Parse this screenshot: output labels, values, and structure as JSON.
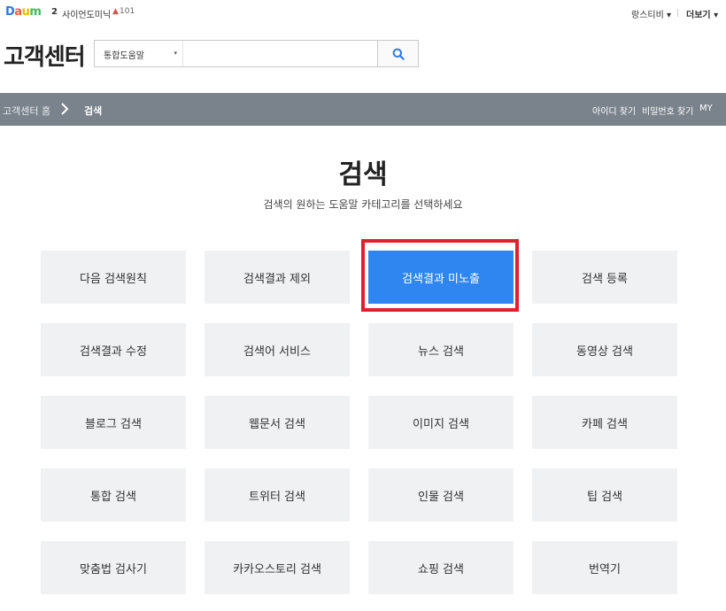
{
  "topbar": {
    "logo": [
      "D",
      "a",
      "u",
      "m",
      ""
    ],
    "rank_number": "2",
    "rank_term": "사이언도미닉",
    "rank_up_icon": "▲",
    "rank_count": "101",
    "user_label": "랑스티비 ▾",
    "more_label": "더보기 ▾"
  },
  "header": {
    "title": "고객센터",
    "search": {
      "select_value": "통합도움말",
      "select_caret": "▾",
      "input_value": "",
      "input_placeholder": "",
      "button_icon": "search-icon",
      "accent_color": "#2a7be4"
    }
  },
  "nav": {
    "breadcrumb_home": "고객센터 홈",
    "breadcrumb_current": "검색",
    "links": [
      "아이디 찾기",
      "비밀번호 찾기",
      "MY"
    ],
    "background_color": "#7a838b"
  },
  "main": {
    "title": "검색",
    "subtitle": "검색의 원하는 도움말 카테고리를 선택하세요",
    "tiles": [
      "다음 검색원칙",
      "검색결과 제외",
      "검색결과 미노출",
      "검색 등록",
      "검색결과 수정",
      "검색어 서비스",
      "뉴스 검색",
      "동영상 검색",
      "블로그 검색",
      "웹문서 검색",
      "이미지 검색",
      "카페 검색",
      "통합 검색",
      "트위터 검색",
      "인물 검색",
      "팁 검색",
      "맞춤법 검사기",
      "카카오스토리 검색",
      "쇼핑 검색",
      "번역기"
    ],
    "active_tile": "검색결과 미노출",
    "active_color": "#2f86f0",
    "highlight_color": "#e0202b"
  }
}
